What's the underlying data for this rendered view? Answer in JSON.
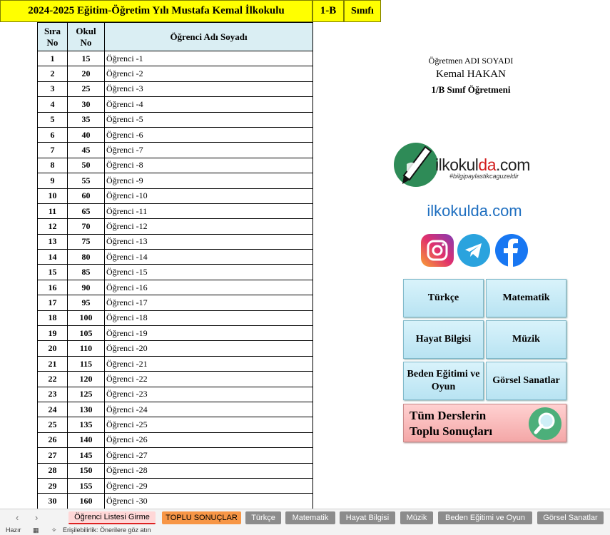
{
  "header": {
    "title": "2024-2025 Eğitim-Öğretim Yılı Mustafa Kemal İlkokulu",
    "class": "1-B",
    "class_label": "Sınıfı"
  },
  "table": {
    "headers": {
      "sira": "Sıra\nNo",
      "okul": "Okul\nNo",
      "name": "Öğrenci Adı Soyadı"
    },
    "rows": [
      {
        "s": "1",
        "n": "15",
        "name": "Öğrenci -1"
      },
      {
        "s": "2",
        "n": "20",
        "name": "Öğrenci -2"
      },
      {
        "s": "3",
        "n": "25",
        "name": "Öğrenci -3"
      },
      {
        "s": "4",
        "n": "30",
        "name": "Öğrenci -4"
      },
      {
        "s": "5",
        "n": "35",
        "name": "Öğrenci -5"
      },
      {
        "s": "6",
        "n": "40",
        "name": "Öğrenci -6"
      },
      {
        "s": "7",
        "n": "45",
        "name": "Öğrenci -7"
      },
      {
        "s": "8",
        "n": "50",
        "name": "Öğrenci -8"
      },
      {
        "s": "9",
        "n": "55",
        "name": "Öğrenci -9"
      },
      {
        "s": "10",
        "n": "60",
        "name": "Öğrenci -10"
      },
      {
        "s": "11",
        "n": "65",
        "name": "Öğrenci -11"
      },
      {
        "s": "12",
        "n": "70",
        "name": "Öğrenci -12"
      },
      {
        "s": "13",
        "n": "75",
        "name": "Öğrenci -13"
      },
      {
        "s": "14",
        "n": "80",
        "name": "Öğrenci -14"
      },
      {
        "s": "15",
        "n": "85",
        "name": "Öğrenci -15"
      },
      {
        "s": "16",
        "n": "90",
        "name": "Öğrenci -16"
      },
      {
        "s": "17",
        "n": "95",
        "name": "Öğrenci -17"
      },
      {
        "s": "18",
        "n": "100",
        "name": "Öğrenci -18"
      },
      {
        "s": "19",
        "n": "105",
        "name": "Öğrenci -19"
      },
      {
        "s": "20",
        "n": "110",
        "name": "Öğrenci -20"
      },
      {
        "s": "21",
        "n": "115",
        "name": "Öğrenci -21"
      },
      {
        "s": "22",
        "n": "120",
        "name": "Öğrenci -22"
      },
      {
        "s": "23",
        "n": "125",
        "name": "Öğrenci -23"
      },
      {
        "s": "24",
        "n": "130",
        "name": "Öğrenci -24"
      },
      {
        "s": "25",
        "n": "135",
        "name": "Öğrenci -25"
      },
      {
        "s": "26",
        "n": "140",
        "name": "Öğrenci -26"
      },
      {
        "s": "27",
        "n": "145",
        "name": "Öğrenci -27"
      },
      {
        "s": "28",
        "n": "150",
        "name": "Öğrenci -28"
      },
      {
        "s": "29",
        "n": "155",
        "name": "Öğrenci -29"
      },
      {
        "s": "30",
        "n": "160",
        "name": "Öğrenci -30"
      }
    ]
  },
  "teacher": {
    "label": "Öğretmen ADI SOYADI",
    "name": "Kemal HAKAN",
    "role": "1/B Sınıf Öğretmeni"
  },
  "logo": {
    "text_main": "ilkokul",
    "text_accent": "da",
    "text_tail": ".com",
    "tagline": "#bilgipaylastikcaguzeldir"
  },
  "site": "ilkokulda.com",
  "social_icons": [
    "instagram-icon",
    "telegram-icon",
    "facebook-icon"
  ],
  "buttons": {
    "turkce": "Türkçe",
    "matematik": "Matematik",
    "hayat": "Hayat Bilgisi",
    "muzik": "Müzik",
    "beden": "Beden Eğitimi ve Oyun",
    "gorsel": "Görsel Sanatlar",
    "toplu": "Tüm Derslerin Toplu Sonuçları"
  },
  "tabs": {
    "active": "Öğrenci Listesi Girme",
    "toplu": "TOPLU SONUÇLAR",
    "turkce": "Türkçe",
    "matematik": "Matematik",
    "hayat": "Hayat Bilgisi",
    "muzik": "Müzik",
    "beden": "Beden Eğitimi ve Oyun",
    "gorsel": "Görsel Sanatlar"
  },
  "status": {
    "ready": "Hazır",
    "accessibility": "Erişilebilirlik: Önerilere göz atın"
  },
  "colors": {
    "header": "#ffff00",
    "table_header": "#daeef3",
    "button": "#b8e3f2",
    "big_button": "#f4a7a7",
    "tab_orange": "#f79646"
  }
}
